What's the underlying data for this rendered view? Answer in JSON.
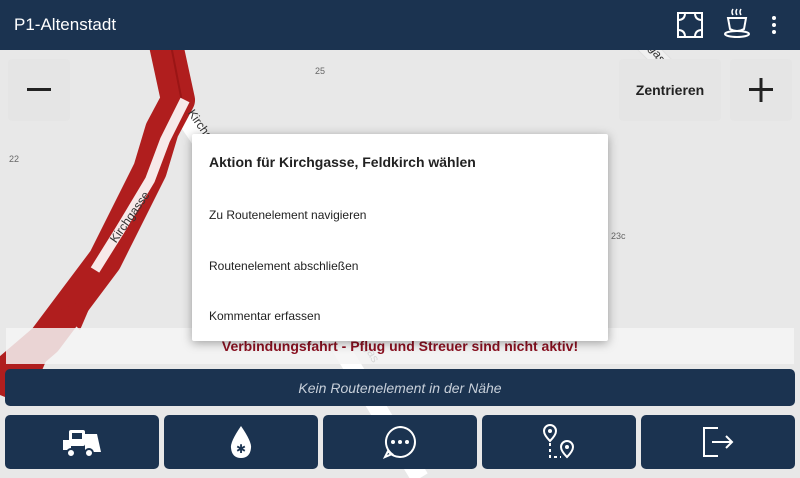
{
  "app": {
    "title": "P1-Altenstadt"
  },
  "topbar_icons": [
    "fullscreen-icon",
    "coffee-break-icon",
    "more-vert-icon"
  ],
  "map": {
    "center_label": "Zentrieren",
    "zoom_in_label": "+",
    "zoom_out_label": "−",
    "house_numbers": [
      "25",
      "22",
      "23c"
    ],
    "street_labels": [
      "Kirchgasse",
      "Kirchgasse",
      "gasse",
      "gas"
    ]
  },
  "dialog": {
    "title": "Aktion für Kirchgasse, Feldkirch wählen",
    "items": [
      "Zu Routenelement navigieren",
      "Routenelement abschließen",
      "Kommentar erfassen"
    ]
  },
  "banner": {
    "warning": "Verbindungsfahrt - Pflug und Streuer sind nicht aktiv!"
  },
  "status": {
    "text": "Kein Routenelement in der Nähe"
  },
  "bottom_buttons": [
    "snowplow-truck-icon",
    "salt-drop-icon",
    "chat-icon",
    "route-icon",
    "exit-icon"
  ],
  "colors": {
    "bar": "#1b3350",
    "route_red": "#b01e1e",
    "warning_text": "#8a1020"
  }
}
